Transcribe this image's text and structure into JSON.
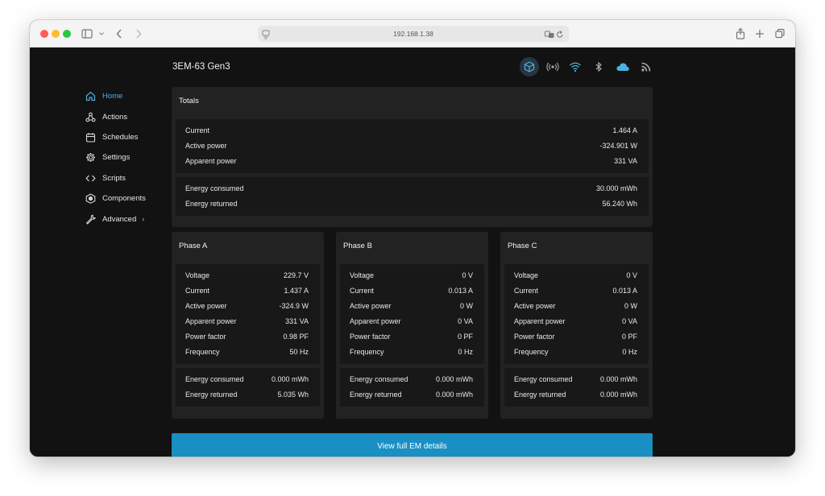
{
  "browser": {
    "url": "192.168.1.38"
  },
  "device": {
    "title": "3EM-63 Gen3"
  },
  "nav": {
    "items": [
      {
        "label": "Home",
        "icon": "home-icon",
        "active": true
      },
      {
        "label": "Actions",
        "icon": "actions-icon"
      },
      {
        "label": "Schedules",
        "icon": "calendar-icon"
      },
      {
        "label": "Settings",
        "icon": "gear-icon"
      },
      {
        "label": "Scripts",
        "icon": "code-icon"
      },
      {
        "label": "Components",
        "icon": "components-icon"
      },
      {
        "label": "Advanced",
        "icon": "wrench-icon"
      }
    ],
    "advanced_chevron": "›"
  },
  "totals": {
    "title": "Totals",
    "power": [
      {
        "label": "Current",
        "value": "1.464 A"
      },
      {
        "label": "Active power",
        "value": "-324.901 W"
      },
      {
        "label": "Apparent power",
        "value": "331 VA"
      }
    ],
    "energy": [
      {
        "label": "Energy consumed",
        "value": "30.000 mWh"
      },
      {
        "label": "Energy returned",
        "value": "56.240 Wh"
      }
    ]
  },
  "phases": [
    {
      "title": "Phase A",
      "metrics": [
        {
          "label": "Voltage",
          "value": "229.7 V"
        },
        {
          "label": "Current",
          "value": "1.437 A"
        },
        {
          "label": "Active power",
          "value": "-324.9 W"
        },
        {
          "label": "Apparent power",
          "value": "331 VA"
        },
        {
          "label": "Power factor",
          "value": "0.98 PF"
        },
        {
          "label": "Frequency",
          "value": "50 Hz"
        }
      ],
      "energy": [
        {
          "label": "Energy consumed",
          "value": "0.000 mWh"
        },
        {
          "label": "Energy returned",
          "value": "5.035 Wh"
        }
      ]
    },
    {
      "title": "Phase B",
      "metrics": [
        {
          "label": "Voltage",
          "value": "0 V"
        },
        {
          "label": "Current",
          "value": "0.013 A"
        },
        {
          "label": "Active power",
          "value": "0 W"
        },
        {
          "label": "Apparent power",
          "value": "0 VA"
        },
        {
          "label": "Power factor",
          "value": "0 PF"
        },
        {
          "label": "Frequency",
          "value": "0 Hz"
        }
      ],
      "energy": [
        {
          "label": "Energy consumed",
          "value": "0.000 mWh"
        },
        {
          "label": "Energy returned",
          "value": "0.000 mWh"
        }
      ]
    },
    {
      "title": "Phase C",
      "metrics": [
        {
          "label": "Voltage",
          "value": "0 V"
        },
        {
          "label": "Current",
          "value": "0.013 A"
        },
        {
          "label": "Active power",
          "value": "0 W"
        },
        {
          "label": "Apparent power",
          "value": "0 VA"
        },
        {
          "label": "Power factor",
          "value": "0 PF"
        },
        {
          "label": "Frequency",
          "value": "0 Hz"
        }
      ],
      "energy": [
        {
          "label": "Energy consumed",
          "value": "0.000 mWh"
        },
        {
          "label": "Energy returned",
          "value": "0.000 mWh"
        }
      ]
    }
  ],
  "actions": {
    "view_details": "View full EM details"
  },
  "status_icons": [
    "device-cube-icon",
    "radio-icon",
    "wifi-icon",
    "bluetooth-icon",
    "cloud-icon",
    "rss-icon"
  ],
  "colors": {
    "accent": "#1a8fc3",
    "active_nav": "#4cb1e0",
    "background": "#121212",
    "card": "#222222",
    "inner": "#181818"
  }
}
